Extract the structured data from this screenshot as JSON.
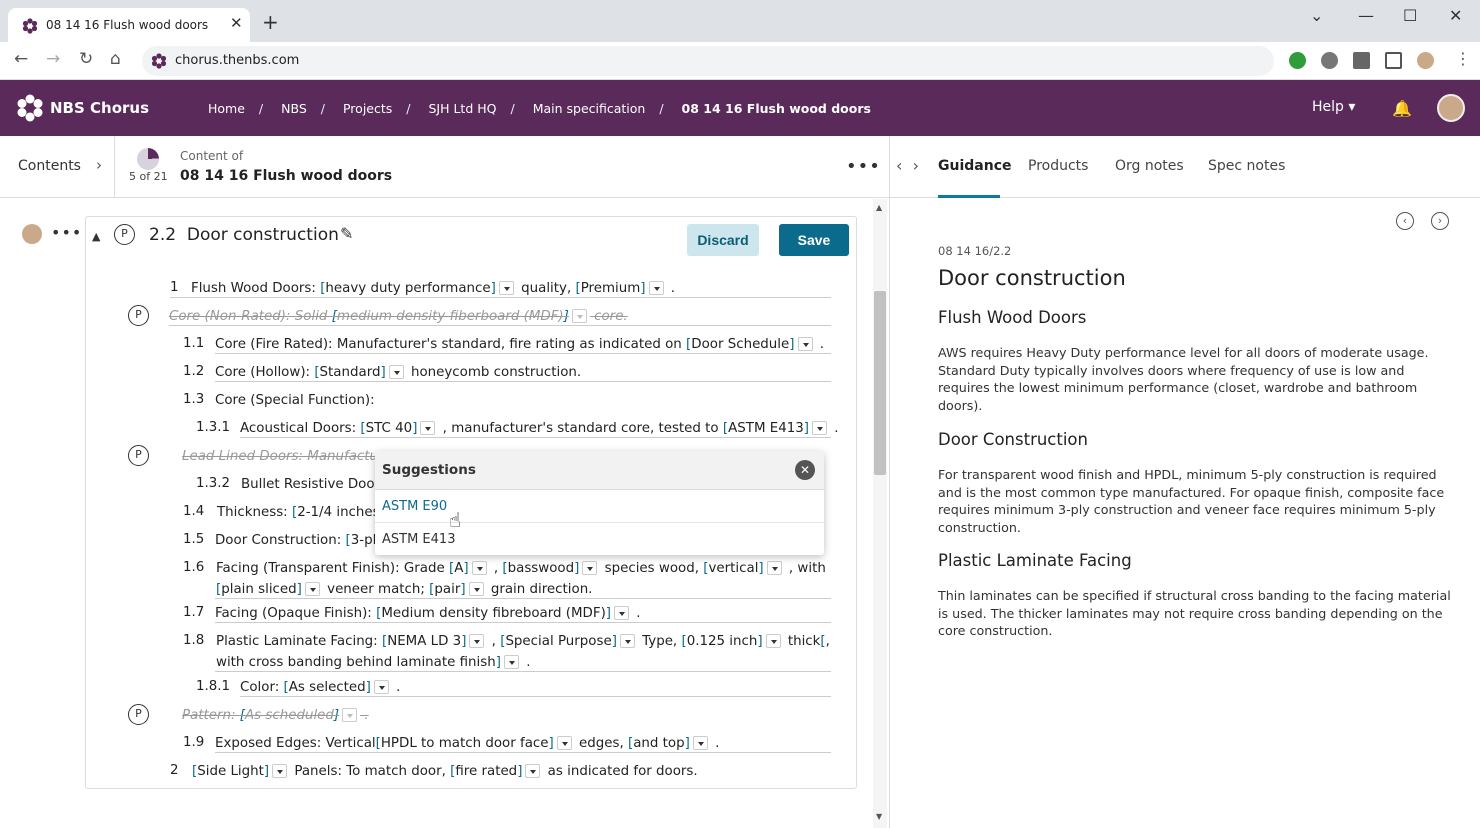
{
  "browser": {
    "tab_title": "08 14 16 Flush wood doors",
    "url": "chorus.thenbs.com"
  },
  "app": {
    "brand": "NBS Chorus",
    "breadcrumbs": [
      "Home",
      "NBS",
      "Projects",
      "SJH Ltd HQ",
      "Main specification",
      "08 14 16 Flush wood doors"
    ],
    "help_label": "Help"
  },
  "doc_header": {
    "contents_label": "Contents",
    "page_count": "5 of 21",
    "progress_fraction": 0.24,
    "content_of_label": "Content of",
    "doc_title": "08 14 16 Flush wood doors"
  },
  "clause": {
    "number": "2.2",
    "title": "Door construction",
    "discard_label": "Discard",
    "save_label": "Save"
  },
  "lines": [
    {
      "num": "1",
      "text": "Flush Wood Doors: [heavy duty performance] quality, [Premium] ."
    },
    {
      "num": "",
      "text": "Core (Non-Rated): Solid [medium density fiberboard (MDF)] core.",
      "struck": true
    },
    {
      "num": "1.1",
      "text": "Core (Fire Rated): Manufacturer's standard, fire rating as indicated on [Door Schedule] ."
    },
    {
      "num": "1.2",
      "text": "Core (Hollow): [Standard] honeycomb construction."
    },
    {
      "num": "1.3",
      "text": "Core (Special Function):"
    },
    {
      "num": "1.3.1",
      "text": "Acoustical Doors: [STC 40] , manufacturer's standard core, tested to [ASTM E413] ."
    },
    {
      "num": "",
      "text": "Lead Lined Doors: Manufactur",
      "struck": true
    },
    {
      "num": "1.3.2",
      "text": "Bullet Resistive Door"
    },
    {
      "num": "1.4",
      "text": "Thickness: [2-1/4 inches"
    },
    {
      "num": "1.5",
      "text": "Door Construction: [3-pl"
    },
    {
      "num": "1.6",
      "text": "Facing (Transparent Finish): Grade [A] , [basswood] species wood, [vertical] , with [plain sliced] veneer match; [pair] grain direction."
    },
    {
      "num": "1.7",
      "text": "Facing (Opaque Finish): [Medium density fibreboard (MDF)] ."
    },
    {
      "num": "1.8",
      "text": "Plastic Laminate Facing: [NEMA LD 3] , [Special Purpose] Type, [0.125 inch] thick[, with cross banding behind laminate finish] ."
    },
    {
      "num": "1.8.1",
      "text": "Color: [As selected] ."
    },
    {
      "num": "",
      "text": "Pattern: [As scheduled] .",
      "struck": true
    },
    {
      "num": "1.9",
      "text": "Exposed Edges: Vertical[HPDL to match door face] edges, [and top] ."
    },
    {
      "num": "2",
      "text": "[Side Light] Panels: To match door, [fire rated] as indicated for doors."
    }
  ],
  "suggestions": {
    "title": "Suggestions",
    "options": [
      "ASTM E90",
      "ASTM E413"
    ]
  },
  "guidance_panel": {
    "tabs": [
      "Guidance",
      "Products",
      "Org notes",
      "Spec notes"
    ],
    "ref": "08 14 16/2.2",
    "title": "Door construction",
    "sections": [
      {
        "heading": "Flush Wood Doors",
        "body": "AWS requires Heavy Duty performance level for all doors of moderate usage. Standard Duty typically involves doors where frequency of use is low and requires the lowest minimum performance (closet, wardrobe and bathroom doors)."
      },
      {
        "heading": "Door Construction",
        "body": "For transparent wood finish and HPDL, minimum 5-ply construction is required and is the most common type manufactured. For opaque finish, composite face requires minimum 3-ply construction and veneer face requires minimum 5-ply construction."
      },
      {
        "heading": "Plastic Laminate Facing",
        "body": "Thin laminates can be specified if structural cross banding to the facing material is used. The thicker laminates may not require cross banding depending on the core construction."
      }
    ]
  },
  "colors": {
    "brand": "#5a2a5a",
    "accent": "#0b6b8c"
  }
}
